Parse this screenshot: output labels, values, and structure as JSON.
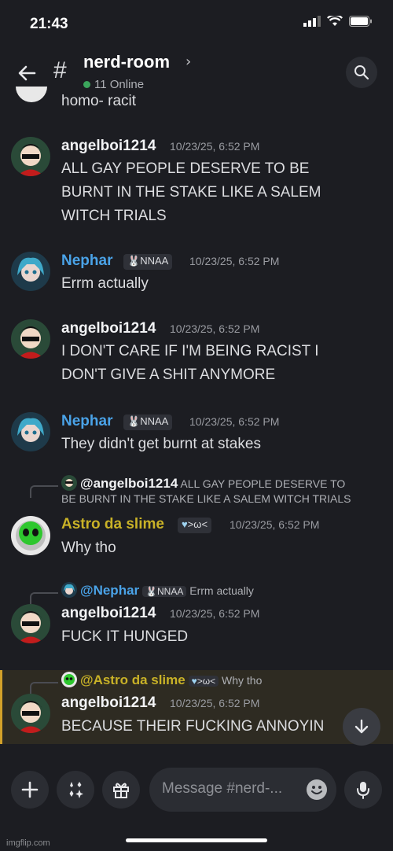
{
  "status": {
    "time": "21:43"
  },
  "header": {
    "channel": "nerd-room",
    "online": "11 Online"
  },
  "chat": {
    "prev_text": "homo- racit",
    "messages": [
      {
        "user": "angelboi1214",
        "time": "10/23/25, 6:52 PM",
        "lines": [
          "ALL GAY PEOPLE DESERVE TO BE",
          "BURNT IN THE STAKE LIKE A SALEM",
          "WITCH TRIALS"
        ]
      },
      {
        "user": "Nephar",
        "tag": "NNAA",
        "time": "10/23/25, 6:52 PM",
        "lines": [
          "Errm actually"
        ]
      },
      {
        "user": "angelboi1214",
        "time": "10/23/25, 6:52 PM",
        "lines": [
          "I DON'T CARE IF I'M BEING RACIST I",
          "DON'T GIVE A SHIT ANYMORE"
        ]
      },
      {
        "user": "Nephar",
        "tag": "NNAA",
        "time": "10/23/25, 6:52 PM",
        "lines": [
          "They didn't get burnt at stakes"
        ]
      },
      {
        "reply_to": "@angelboi1214",
        "reply_text_1": "ALL GAY PEOPLE DESERVE TO",
        "reply_text_2": "BE BURNT IN THE STAKE LIKE A SALEM WITCH TRIALS",
        "user": "Astro da slime",
        "tag": ">ω<",
        "time": "10/23/25, 6:52 PM",
        "lines": [
          "Why tho"
        ]
      },
      {
        "reply_to": "@Nephar",
        "reply_tag": "NNAA",
        "reply_text": "Errm actually",
        "user": "angelboi1214",
        "time": "10/23/25, 6:52 PM",
        "lines": [
          "FUCK IT HUNGED"
        ]
      },
      {
        "reply_to": "@Astro da slime",
        "reply_tag": ">ω<",
        "reply_text": "Why tho",
        "user": "angelboi1214",
        "time": "10/23/25, 6:52 PM",
        "lines": [
          "BECAUSE THEIR FUCKING ANNOYIN"
        ]
      }
    ]
  },
  "composer": {
    "placeholder": "Message #nerd-..."
  },
  "watermark": "imgflip.com",
  "colors": {
    "nephar": "#4aa3e8",
    "astro": "#c9b227",
    "angel": "#f2f3f5",
    "highlight_border": "#d3a12a"
  }
}
